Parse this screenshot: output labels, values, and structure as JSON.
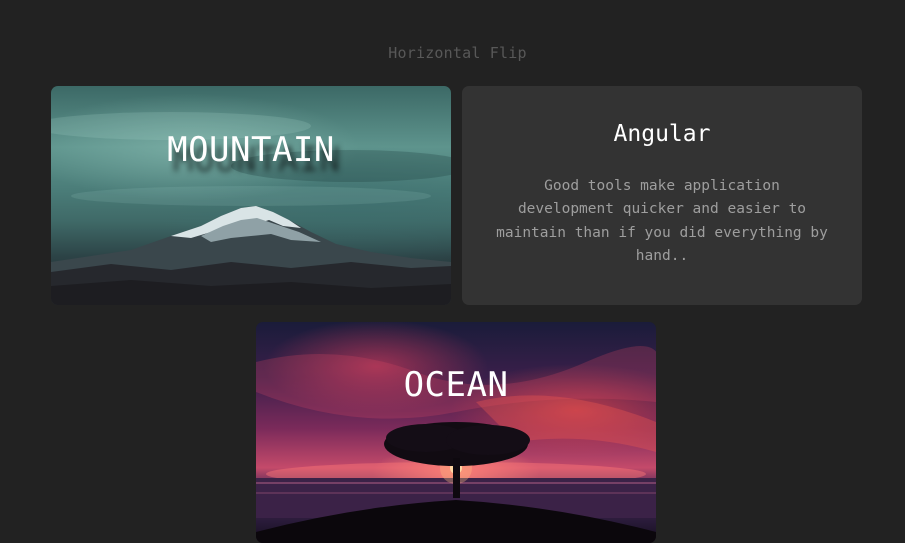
{
  "page": {
    "title": "Horizontal Flip"
  },
  "cards": {
    "mountain": {
      "label": "MOUNTAIN",
      "image": "mountain-photo"
    },
    "angular": {
      "title": "Angular",
      "text": "Good tools make application development quicker and easier to maintain than if you did everything by hand.."
    },
    "ocean": {
      "label": "OCEAN",
      "image": "ocean-sunset-tree-photo"
    }
  },
  "colors": {
    "background": "#222222",
    "card_back": "#333333",
    "title_text": "#585858",
    "body_text": "#9e9e9e"
  }
}
